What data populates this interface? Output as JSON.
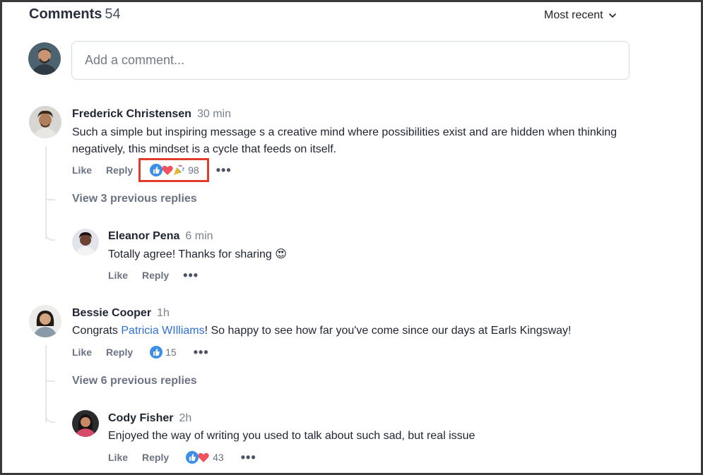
{
  "header": {
    "title": "Comments",
    "count": "54",
    "sort_label": "Most recent"
  },
  "composer": {
    "placeholder": "Add a comment..."
  },
  "comments": [
    {
      "author": "Frederick Christensen",
      "time": "30 min",
      "text": "Such a simple but inspiring message s a creative mind where possibilities exist and are hidden when thinking negatively, this mindset is a cycle that feeds on itself.",
      "like_label": "Like",
      "reply_label": "Reply",
      "reactions": [
        "like",
        "heart",
        "party"
      ],
      "reaction_count": "98",
      "view_previous": "View 3 previous replies",
      "reply": {
        "author": "Eleanor Pena",
        "time": "6 min",
        "text": "Totally agree! Thanks for sharing 😍",
        "like_label": "Like",
        "reply_label": "Reply"
      }
    },
    {
      "author": "Bessie Cooper",
      "time": "1h",
      "text_before": "Congrats ",
      "mention": "Patricia WIlliams",
      "text_after": "! So happy to see how far you've come since our days at Earls Kingsway!",
      "like_label": "Like",
      "reply_label": "Reply",
      "reactions": [
        "like"
      ],
      "reaction_count": "15",
      "view_previous": "View 6 previous replies",
      "reply": {
        "author": "Cody Fisher",
        "time": "2h",
        "text": "Enjoyed the way of writing you used to talk about such sad, but real issue",
        "like_label": "Like",
        "reply_label": "Reply",
        "reactions": [
          "like",
          "heart"
        ],
        "reaction_count": "43"
      }
    }
  ],
  "colors": {
    "mention": "#2f6fd6",
    "highlight": "#e23b2e",
    "like": "#3b8fe8",
    "heart": "#f0525e"
  }
}
